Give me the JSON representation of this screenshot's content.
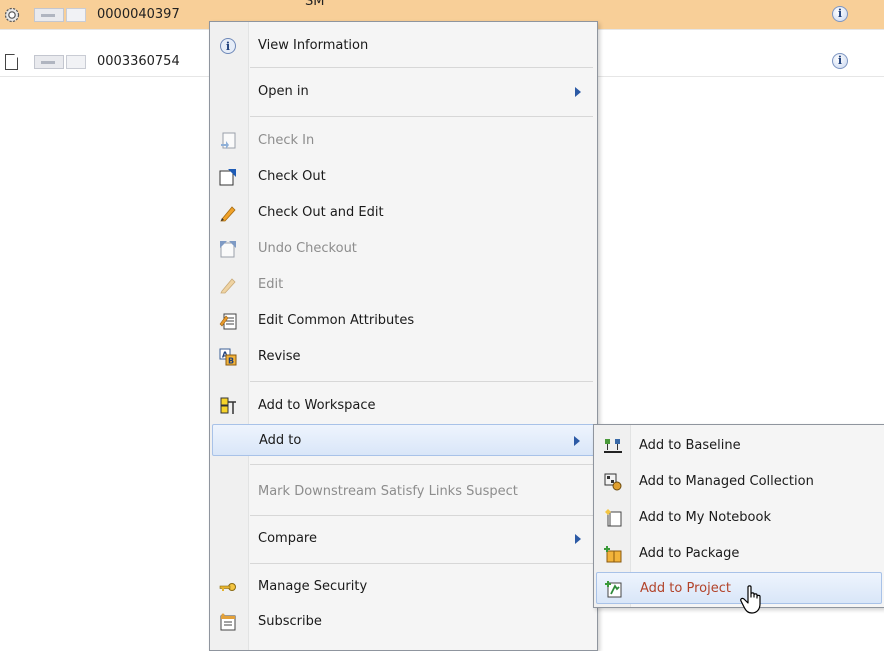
{
  "rows": [
    {
      "id": "0000040397",
      "extra": "SM",
      "selected": true
    },
    {
      "id": "0003360754",
      "extra": "",
      "selected": false
    }
  ],
  "menu": {
    "items": [
      {
        "label": "View Information",
        "icon": "info-icon",
        "enabled": true
      },
      {
        "label": "Open in",
        "icon": "",
        "enabled": true,
        "submenu": true
      },
      {
        "label": "Check In",
        "icon": "check-in-icon",
        "enabled": false
      },
      {
        "label": "Check Out",
        "icon": "check-out-icon",
        "enabled": true
      },
      {
        "label": "Check Out and Edit",
        "icon": "pencil-icon",
        "enabled": true
      },
      {
        "label": "Undo Checkout",
        "icon": "undo-checkout-icon",
        "enabled": false
      },
      {
        "label": "Edit",
        "icon": "pencil-icon",
        "enabled": false
      },
      {
        "label": "Edit Common Attributes",
        "icon": "edit-attributes-icon",
        "enabled": true
      },
      {
        "label": "Revise",
        "icon": "revise-icon",
        "enabled": true
      },
      {
        "label": "Add to Workspace",
        "icon": "workspace-icon",
        "enabled": true
      },
      {
        "label": "Add to",
        "icon": "",
        "enabled": true,
        "submenu": true,
        "highlighted": true
      },
      {
        "label": "Mark Downstream Satisfy Links Suspect",
        "icon": "",
        "enabled": false
      },
      {
        "label": "Compare",
        "icon": "",
        "enabled": true,
        "submenu": true
      },
      {
        "label": "Manage Security",
        "icon": "key-icon",
        "enabled": true
      },
      {
        "label": "Subscribe",
        "icon": "subscribe-icon",
        "enabled": true
      }
    ]
  },
  "submenu": {
    "items": [
      {
        "label": "Add to Baseline",
        "icon": "baseline-icon"
      },
      {
        "label": "Add to Managed Collection",
        "icon": "managed-collection-icon"
      },
      {
        "label": "Add to My Notebook",
        "icon": "notebook-icon"
      },
      {
        "label": "Add to Package",
        "icon": "package-icon"
      },
      {
        "label": "Add to Project",
        "icon": "project-icon",
        "highlighted": true
      }
    ]
  },
  "colors": {
    "selected_row": "#f8cf98",
    "menu_bg": "#f5f5f5",
    "highlight": "#d9e6f8",
    "hot_text": "#b2432a",
    "arrow": "#2c5aa5"
  }
}
